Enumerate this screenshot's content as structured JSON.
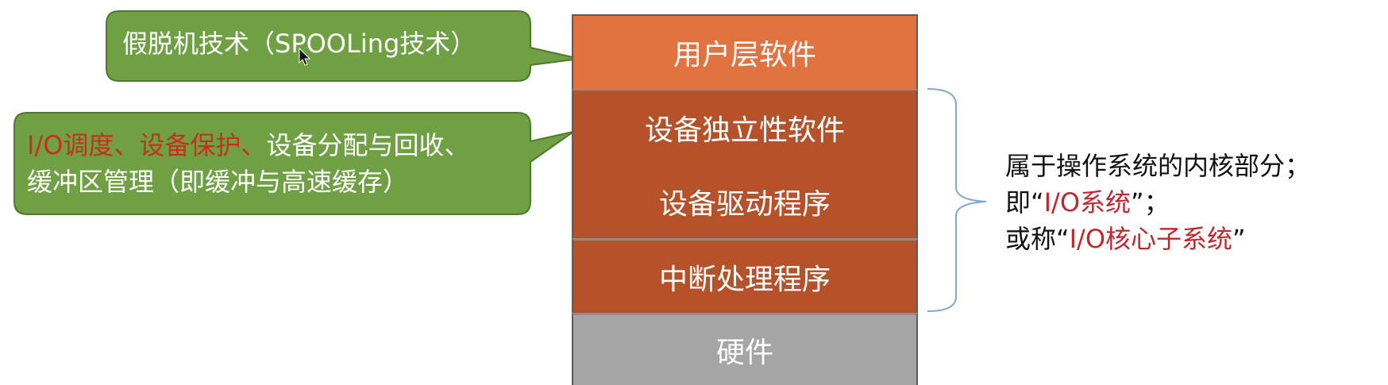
{
  "layers": {
    "user": "用户层软件",
    "device_independent": "设备独立性软件",
    "device_driver": "设备驱动程序",
    "interrupt": "中断处理程序",
    "hardware": "硬件"
  },
  "callouts": {
    "spooling": "假脱机技术（SPOOLing技术）",
    "io_red_1": "I/O调度、",
    "io_red_2": "设备保护、",
    "io_black": "设备分配与回收、",
    "io_line2": "缓冲区管理（即缓冲与高速缓存）"
  },
  "kernel_note": {
    "line1": "属于操作系统的内核部分；",
    "line2_prefix": "即“",
    "line2_red": "I/O系统",
    "line2_suffix": "”；",
    "line3_prefix": "或称“",
    "line3_red": "I/O核心子系统",
    "line3_suffix": "”"
  },
  "colors": {
    "callout_fill": "#70a044",
    "callout_border": "#4f7a2c",
    "user_layer": "#e07340",
    "kernel_layers": "#b5522a",
    "hardware_layer": "#a5a5a5",
    "highlight_red": "#c7301f",
    "brace": "#7fa7cf"
  }
}
